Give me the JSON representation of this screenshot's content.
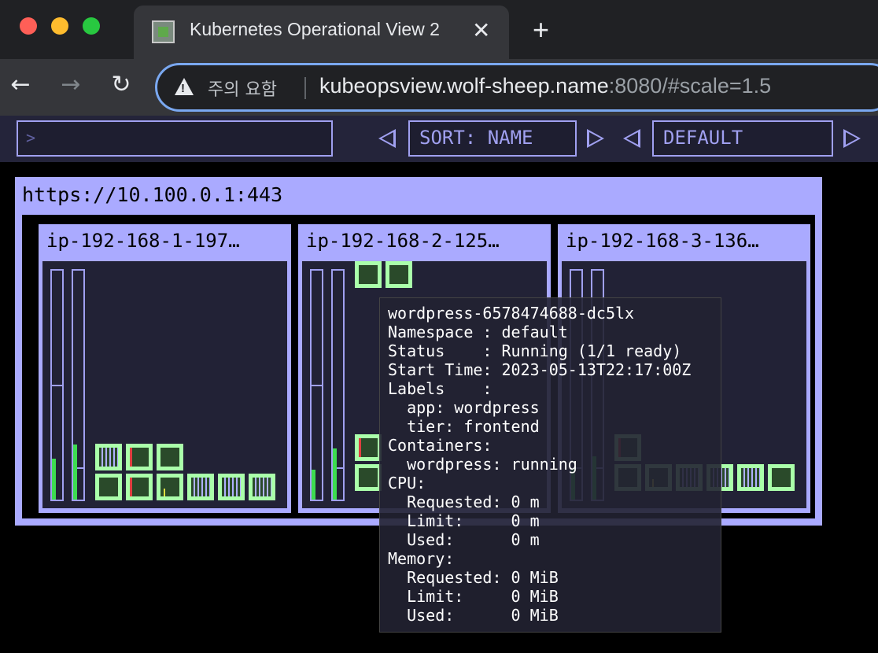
{
  "browser": {
    "tab_title": "Kubernetes Operational View 2",
    "tab_close": "✕",
    "new_tab": "+",
    "warning_text": "주의 요함",
    "url_host": "kubeopsview.wolf-sheep.name",
    "url_rest": ":8080/#scale=1.5",
    "colors": {
      "close": "#ff5f57",
      "minimize": "#febc2e",
      "maximize": "#28c840",
      "omnibox_focus": "#7aa8f0"
    }
  },
  "app": {
    "filter_placeholder": ">",
    "sort_label": "SORT: NAME",
    "namespace_label": "DEFAULT",
    "cluster_title": "https://10.100.0.1:443",
    "nodes": [
      {
        "name": "ip-192-168-1-197…"
      },
      {
        "name": "ip-192-168-2-125…"
      },
      {
        "name": "ip-192-168-3-136…"
      }
    ],
    "colors": {
      "accent": "#aaaaff",
      "pod_border": "#aaffaa",
      "usage_fill": "#3ddc50",
      "background": "#000000"
    }
  },
  "tooltip": {
    "lines": [
      "wordpress-6578474688-dc5lx",
      "Namespace : default",
      "Status    : Running (1/1 ready)",
      "Start Time: 2023-05-13T22:17:00Z",
      "Labels    :",
      "  app: wordpress",
      "  tier: frontend",
      "Containers:",
      "  wordpress: running",
      "CPU:",
      "  Requested: 0 m",
      "  Limit:     0 m",
      "  Used:      0 m",
      "Memory:",
      "  Requested: 0 MiB",
      "  Limit:     0 MiB",
      "  Used:      0 MiB"
    ]
  }
}
